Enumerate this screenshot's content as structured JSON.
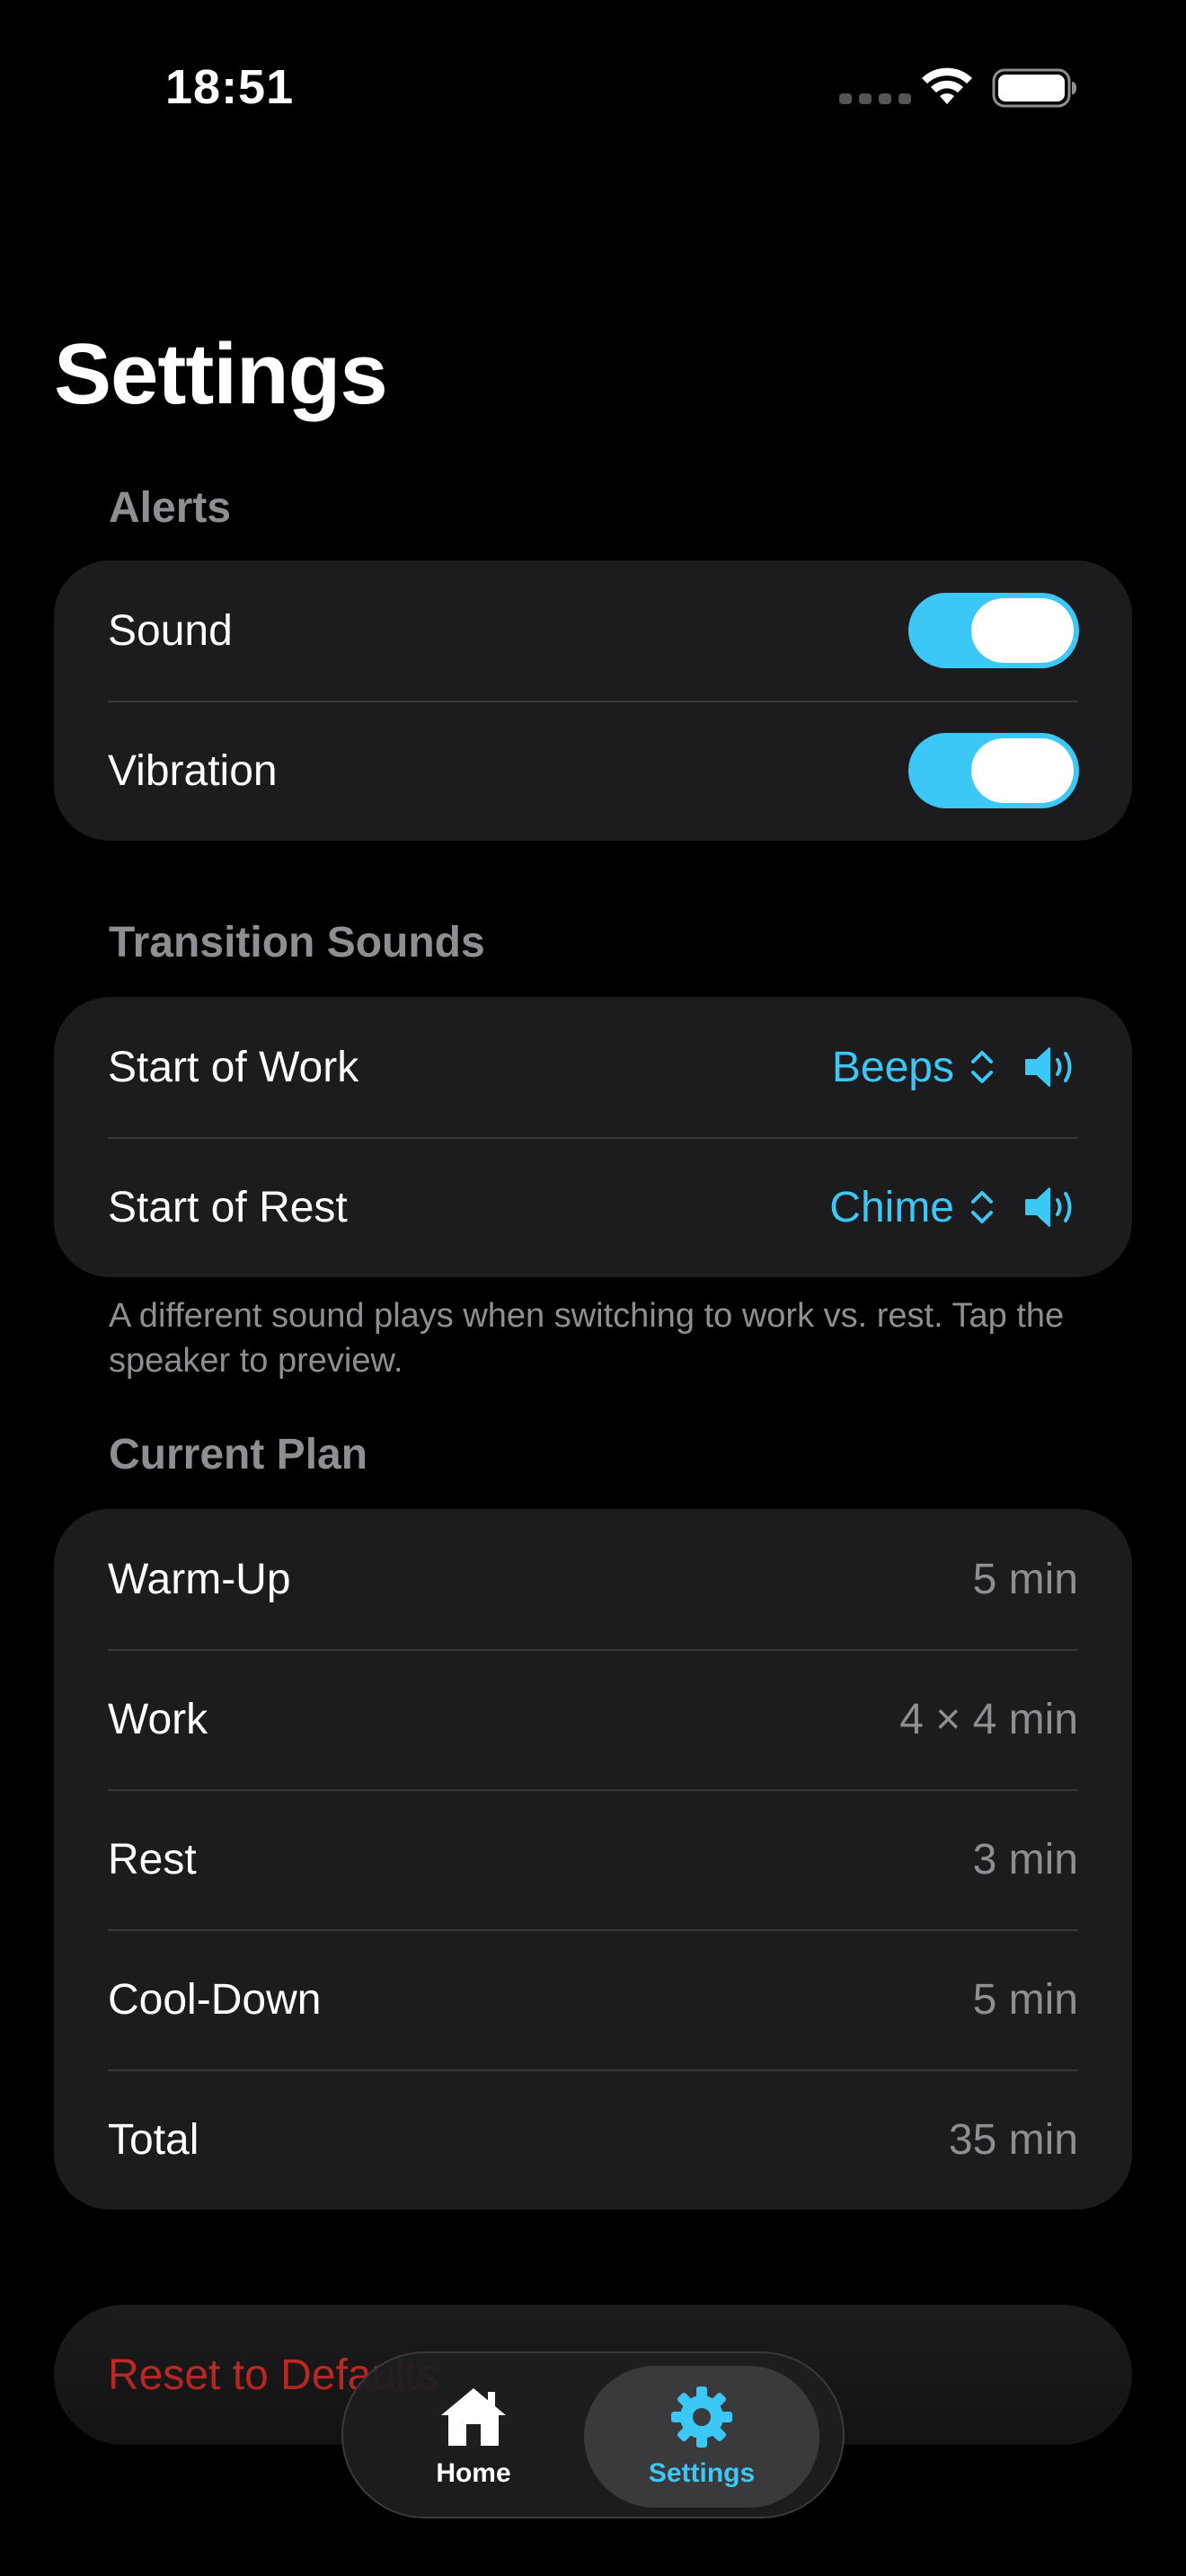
{
  "status_bar": {
    "time": "18:51"
  },
  "page": {
    "title": "Settings"
  },
  "alerts": {
    "header": "Alerts",
    "rows": [
      {
        "label": "Sound",
        "on": true
      },
      {
        "label": "Vibration",
        "on": true
      }
    ]
  },
  "transition_sounds": {
    "header": "Transition Sounds",
    "rows": [
      {
        "label": "Start of Work",
        "value": "Beeps"
      },
      {
        "label": "Start of Rest",
        "value": "Chime"
      }
    ],
    "footnote": "A different sound plays when switching to work vs. rest. Tap the speaker to preview."
  },
  "current_plan": {
    "header": "Current Plan",
    "rows": [
      {
        "label": "Warm-Up",
        "value": "5 min"
      },
      {
        "label": "Work",
        "value": "4 × 4 min"
      },
      {
        "label": "Rest",
        "value": "3 min"
      },
      {
        "label": "Cool-Down",
        "value": "5 min"
      },
      {
        "label": "Total",
        "value": "35 min"
      }
    ]
  },
  "reset": {
    "label": "Reset to Defaults"
  },
  "tab_bar": {
    "home_label": "Home",
    "settings_label": "Settings"
  },
  "colors": {
    "accent": "#3cc8f6",
    "background": "#000000",
    "card": "#1c1c1e",
    "secondary_text": "#8e8e93",
    "destructive": "#e0302a"
  }
}
